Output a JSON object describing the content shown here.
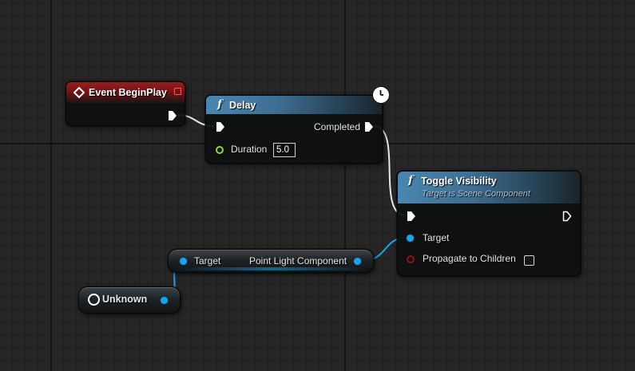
{
  "graph": {
    "event_node": {
      "title": "Event BeginPlay",
      "accent": "#8e1b1b"
    },
    "delay_node": {
      "title": "Delay",
      "completed_label": "Completed",
      "duration_label": "Duration",
      "duration_value": "5.0",
      "badge_icon": "clock-icon"
    },
    "toggle_node": {
      "title": "Toggle Visibility",
      "subtitle": "Target is Scene Component",
      "target_label": "Target",
      "propagate_label": "Propagate to Children",
      "propagate_checked": false
    },
    "get_node": {
      "target_label": "Target",
      "output_label": "Point Light Component"
    },
    "unknown_node": {
      "label": "Unknown"
    },
    "colors": {
      "exec": "#ffffff",
      "object_pin": "#1aa3ee",
      "float_pin": "#8fd63e",
      "bool_pin": "#8b1515",
      "event_header": "#8e1b1b",
      "function_header": "#4a86b0"
    }
  }
}
